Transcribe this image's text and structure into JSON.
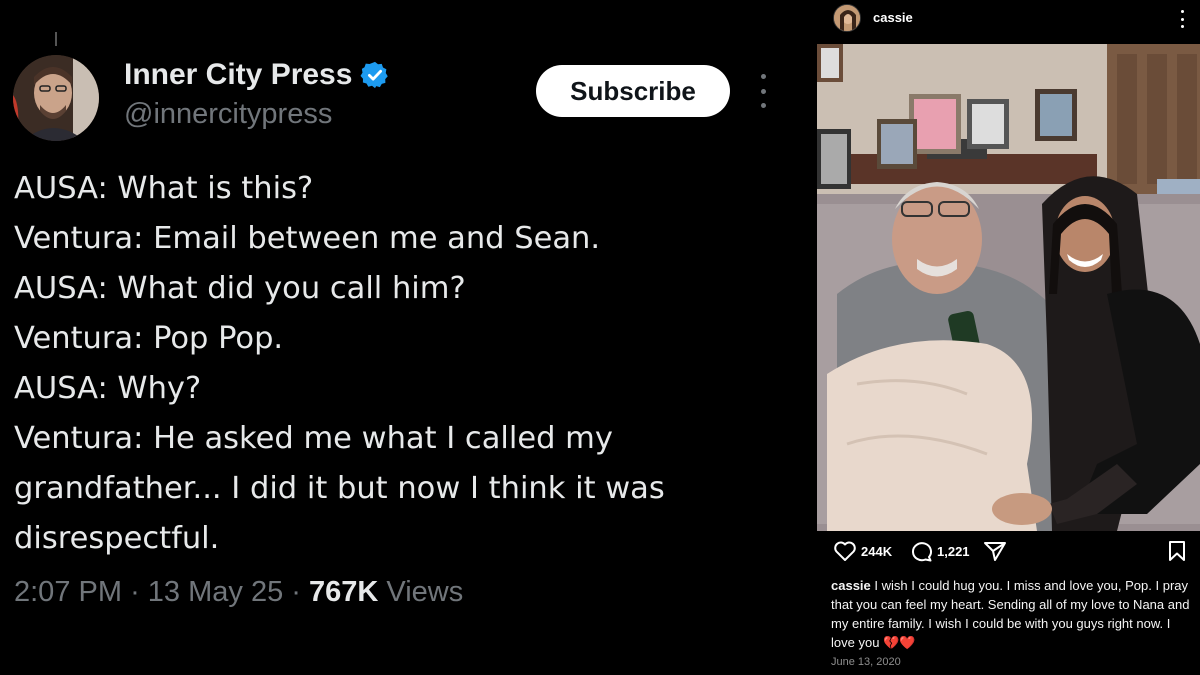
{
  "tweet": {
    "display_name": "Inner City Press",
    "handle": "@innercitypress",
    "subscribe_label": "Subscribe",
    "lines": [
      "AUSA: What is this?",
      "Ventura: Email between me and Sean.",
      "AUSA: What did you call him?",
      "Ventura: Pop Pop.",
      "AUSA: Why?",
      "Ventura: He asked me what I called my",
      "grandfather... I did it but now I think it was",
      "disrespectful."
    ],
    "time": "2:07 PM",
    "separator": "·",
    "date": "13 May 25",
    "views_count": "767K",
    "views_label": "Views"
  },
  "instagram": {
    "username": "cassie",
    "likes": "244K",
    "comments": "1,221",
    "caption_user": "cassie",
    "caption_text": "I wish I could hug you. I miss and love you, Pop. I pray that you can feel my heart. Sending all of my love to Nana and my entire family. I wish I could be with you guys right now. I love you",
    "caption_emoji": "💔❤️",
    "date": "June 13, 2020"
  },
  "colors": {
    "background": "#000000",
    "text_primary": "#e7e9ea",
    "text_secondary": "#71767b",
    "verified_blue": "#1d9bf0",
    "subscribe_bg": "#ffffff"
  }
}
